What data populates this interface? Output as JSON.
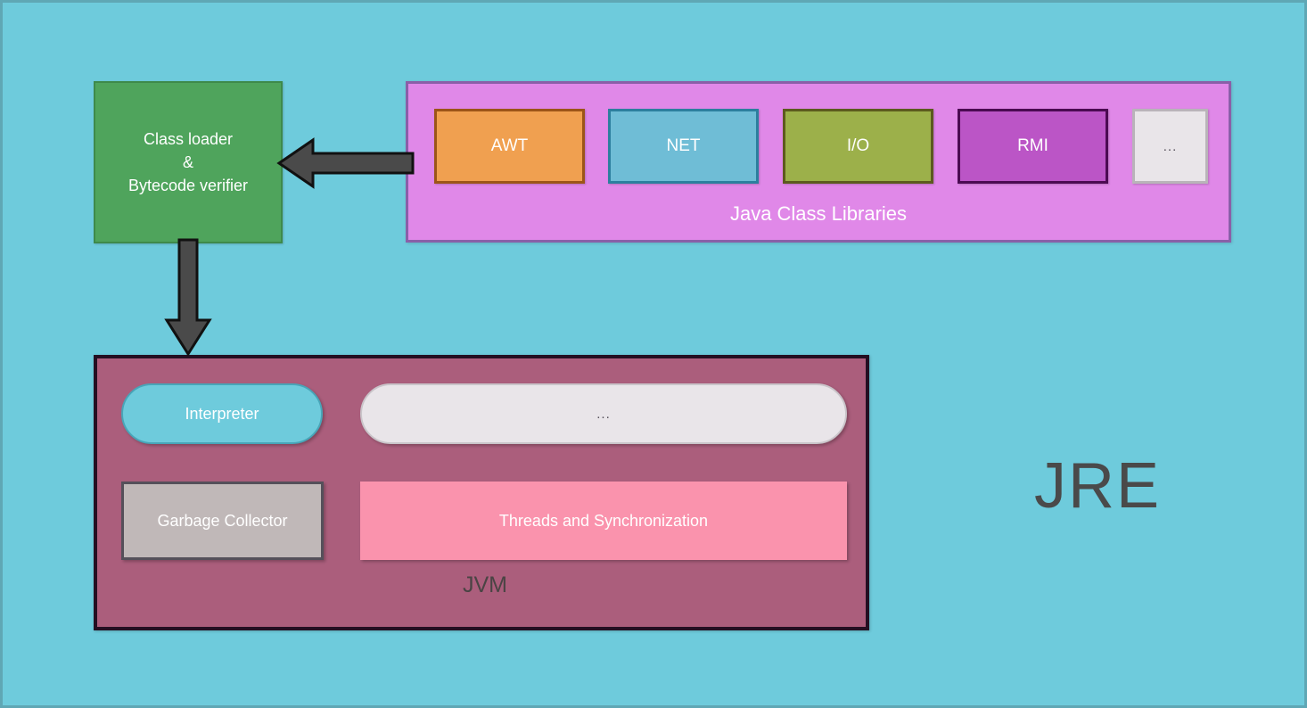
{
  "diagram": {
    "title": "JRE",
    "background_color": "#6ecbdc"
  },
  "class_loader": {
    "line1": "Class loader",
    "line2": "&",
    "line3": "Bytecode verifier",
    "color": "#4fa45c"
  },
  "java_class_libraries": {
    "label": "Java Class Libraries",
    "color": "#e088e8",
    "items": [
      {
        "label": "AWT",
        "color": "#f0a050"
      },
      {
        "label": "NET",
        "color": "#6fbdd6"
      },
      {
        "label": "I/O",
        "color": "#9cb04a"
      },
      {
        "label": "RMI",
        "color": "#bb55c6"
      },
      {
        "label": "...",
        "color": "#e9e5e9"
      }
    ]
  },
  "jvm": {
    "label": "JVM",
    "color": "#ab5e7c",
    "items": [
      {
        "label": "Interpreter",
        "color": "#6ecbdc"
      },
      {
        "label": "...",
        "color": "#e9e5e9"
      },
      {
        "label": "Garbage Collector",
        "color": "#c0b8b8"
      },
      {
        "label": "Threads and Synchronization",
        "color": "#fa93ad"
      }
    ]
  },
  "arrows": [
    {
      "name": "libraries-to-class-loader",
      "direction": "left",
      "color": "#4a4a4a"
    },
    {
      "name": "class-loader-to-jvm",
      "direction": "down",
      "color": "#4a4a4a"
    }
  ]
}
